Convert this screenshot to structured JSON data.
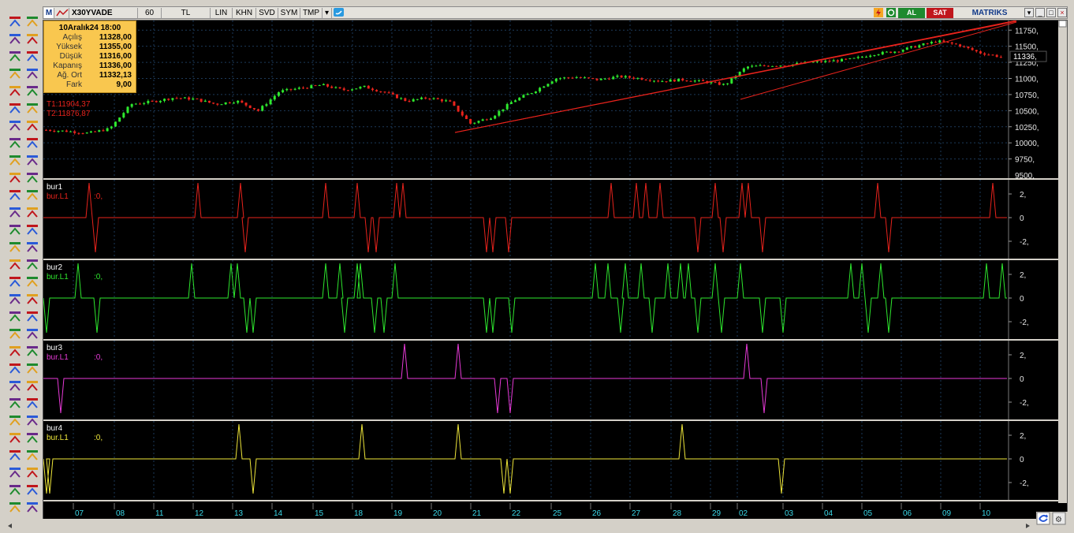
{
  "toolbar": {
    "symbol_badge": "M",
    "symbol": "X30YVADE",
    "period": "60",
    "currency": "TL",
    "buttons": [
      "LIN",
      "KHN",
      "SVD",
      "SYM",
      "TMP"
    ],
    "buy_label": "AL",
    "sell_label": "SAT",
    "brand": "MATRIKS",
    "colors": {
      "buy": "#1e8a2e",
      "sell": "#c0161c",
      "title_bg": "#e4e2dc"
    }
  },
  "infobox": {
    "date": "10Aralık24 18:00",
    "rows": [
      {
        "label": "Açılış",
        "value": "11328,00"
      },
      {
        "label": "Yüksek",
        "value": "11355,00"
      },
      {
        "label": "Düşük",
        "value": "11316,00"
      },
      {
        "label": "Kapanış",
        "value": "11336,00"
      },
      {
        "label": "Ağ. Ort",
        "value": "11332,13"
      },
      {
        "label": "Fark",
        "value": "9,00"
      }
    ]
  },
  "trend_labels": {
    "t1": "T1:11904,37",
    "t2": "T2:11876,87"
  },
  "price_axis": {
    "ticks": [
      "11750,",
      "11500,",
      "11250,",
      "11000,",
      "10750,",
      "10500,",
      "10250,",
      "10000,",
      "9750,",
      "9500,"
    ],
    "last_price": "11336,"
  },
  "panels": [
    {
      "name": "bur1",
      "legend": "bur.L1",
      "value": ":0,",
      "color": "#e8231c",
      "ticks": [
        "2,",
        "0",
        "-2,"
      ]
    },
    {
      "name": "bur2",
      "legend": "bur.L1",
      "value": ":0,",
      "color": "#2ee82e",
      "ticks": [
        "2,",
        "0",
        "-2,"
      ]
    },
    {
      "name": "bur3",
      "legend": "bur.L1",
      "value": ":0,",
      "color": "#e83ad8",
      "ticks": [
        "2,",
        "0",
        "-2,"
      ]
    },
    {
      "name": "bur4",
      "legend": "bur.L1",
      "value": ":0,",
      "color": "#f0e83a",
      "ticks": [
        "2,",
        "0",
        "-2,"
      ]
    }
  ],
  "time_axis": {
    "labels": [
      "07",
      "08",
      "11",
      "12",
      "13",
      "14",
      "15",
      "18",
      "19",
      "20",
      "21",
      "22",
      "25",
      "26",
      "27",
      "28",
      "29",
      "02",
      "03",
      "04",
      "05",
      "06",
      "09",
      "10"
    ],
    "color": "#3ad8e8"
  },
  "chart_data": [
    {
      "type": "candlestick",
      "title": "X30YVADE",
      "ylim": [
        9500,
        11900
      ],
      "yticks": [
        9750,
        10000,
        10250,
        10500,
        10750,
        11000,
        11250,
        11500,
        11750
      ],
      "approx_close_path": [
        10200,
        10180,
        10150,
        10220,
        10600,
        10640,
        10700,
        10680,
        10600,
        10650,
        10500,
        10800,
        10850,
        10900,
        10820,
        10870,
        10780,
        10650,
        10700,
        10640,
        10300,
        10400,
        10650,
        10800,
        11000,
        11020,
        10980,
        11030,
        11000,
        10960,
        10980,
        10950,
        10900,
        11180,
        11200,
        11210,
        11250,
        11270,
        11300,
        11380,
        11420,
        11500,
        11580,
        11520,
        11400,
        11336
      ],
      "last": 11336
    },
    {
      "type": "line",
      "name": "bur1",
      "ylim": [
        -3,
        3
      ],
      "spikes": {
        "up": 14,
        "down": 13
      }
    },
    {
      "type": "line",
      "name": "bur2",
      "ylim": [
        -3,
        3
      ],
      "spikes": {
        "up": 24,
        "down": 18
      }
    },
    {
      "type": "line",
      "name": "bur3",
      "ylim": [
        -3,
        3
      ],
      "spikes": {
        "up": 3,
        "down": 4
      }
    },
    {
      "type": "line",
      "name": "bur4",
      "ylim": [
        -3,
        3
      ],
      "spikes": {
        "up": 4,
        "down": 5
      }
    }
  ]
}
